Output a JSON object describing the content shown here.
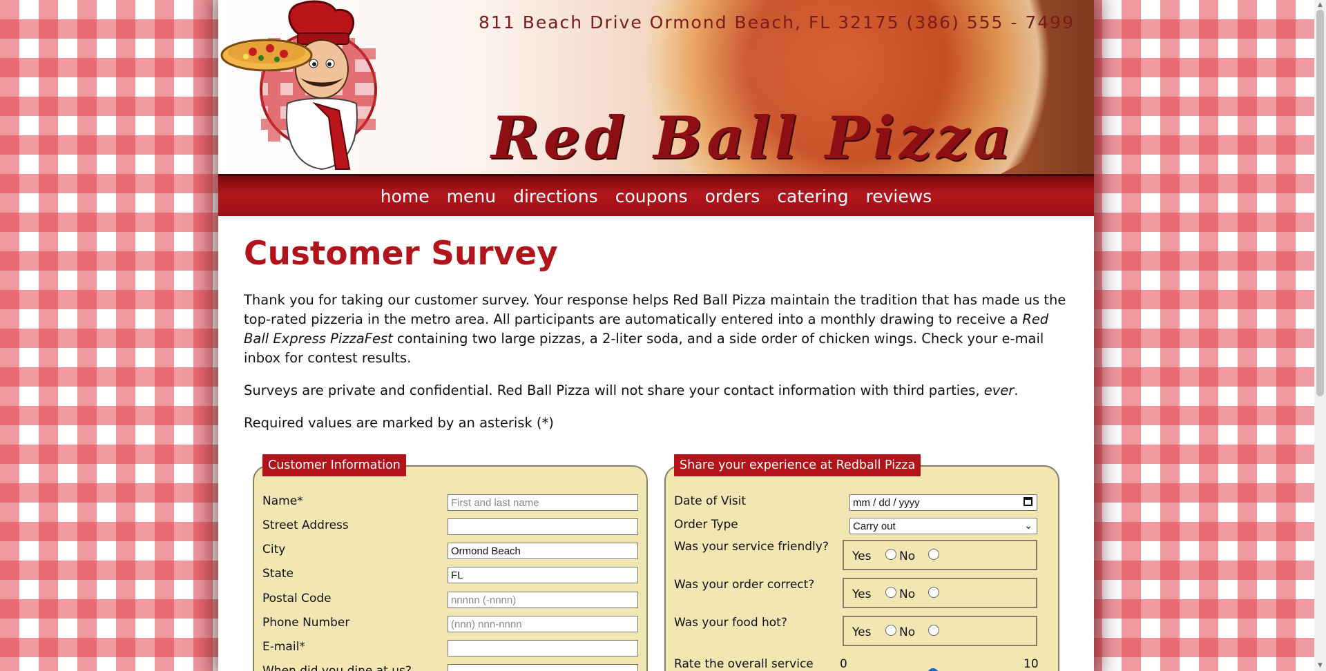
{
  "header": {
    "address": "811 Beach Drive  Ormond Beach, FL 32175   (386) 555 - 7499",
    "brand": "Red Ball Pizza"
  },
  "nav": [
    "home",
    "menu",
    "directions",
    "coupons",
    "orders",
    "catering",
    "reviews"
  ],
  "main": {
    "title": "Customer Survey",
    "intro_1": "Thank you for taking our customer survey. Your response helps Red Ball Pizza maintain the tradition that has made us the top-rated pizzeria in the metro area. All participants are automatically entered into a monthly drawing to receive a",
    "intro_em": "Red Ball Express PizzaFest",
    "intro_2": "containing two large pizzas, a 2-liter soda, and a side order of chicken wings. Check your e-mail inbox for contest results.",
    "privacy_1": "Surveys are private and confidential. Red Ball Pizza will not share your contact information with third parties,",
    "privacy_em": "ever",
    "privacy_2": ".",
    "required_note": "Required values are marked by an asterisk (*)"
  },
  "customer_info": {
    "legend": "Customer Information",
    "name_label": "Name*",
    "name_placeholder": "First and last name",
    "street_label": "Street Address",
    "street_value": "",
    "city_label": "City",
    "city_value": "Ormond Beach",
    "state_label": "State",
    "state_value": "FL",
    "postal_label": "Postal Code",
    "postal_placeholder": "nnnnn (-nnnn)",
    "phone_label": "Phone Number",
    "phone_placeholder": "(nnn) nnn-nnnn",
    "email_label": "E-mail*",
    "email_value": "",
    "next_label": "When did you dine at us?"
  },
  "experience": {
    "legend": "Share your experience at Redball Pizza",
    "date_label": "Date of Visit",
    "date_value": "mm / dd / yyyy",
    "order_label": "Order Type",
    "order_value": "Carry out",
    "friendly_label": "Was your service friendly?",
    "correct_label": "Was your order correct?",
    "hot_label": "Was your food hot?",
    "yes": "Yes",
    "no": "No",
    "rate_label": "Rate the overall service",
    "rate_min": "0",
    "rate_max": "10",
    "rate_value_fraction": 0.5
  },
  "colors": {
    "brand_red": "#b2141b",
    "fieldset_bg": "#f2e6b2",
    "nav_bg": "#9d1016"
  },
  "icons": {
    "calendar": "calendar-icon",
    "dropdown": "chevron-down-icon"
  }
}
